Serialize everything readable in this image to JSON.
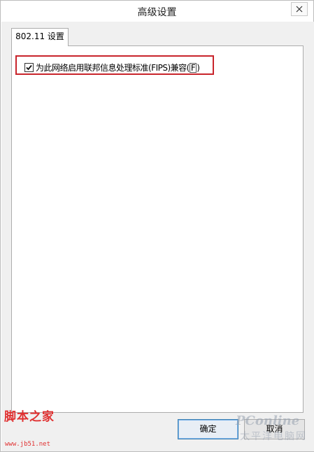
{
  "window": {
    "title": "高级设置"
  },
  "tabs": [
    {
      "label": "802.11 设置",
      "active": true
    }
  ],
  "options": {
    "fips": {
      "label": "为此网络启用联邦信息处理标准(FIPS)兼容(",
      "accelerator": "F",
      "label_suffix": ")",
      "checked": true
    }
  },
  "buttons": {
    "ok": "确定",
    "cancel": "取消"
  },
  "watermarks": {
    "left_logo": "脚本之家",
    "left_url": "www.jb51.net",
    "right_logo": "PConline",
    "right_sub": "太平洋电脑网"
  },
  "colors": {
    "highlight_border": "#c8242b",
    "watermark_red": "#e03030"
  }
}
